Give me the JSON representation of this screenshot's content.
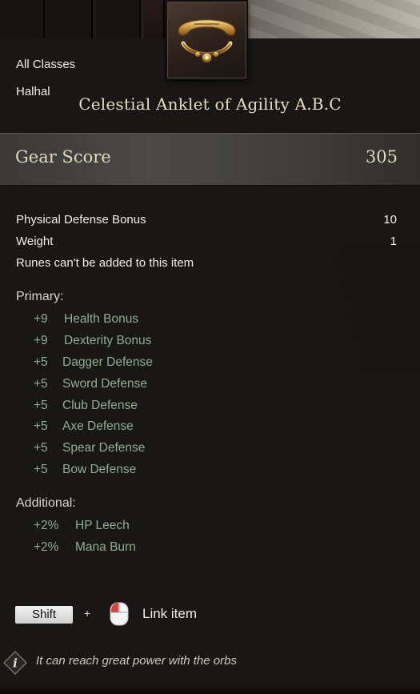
{
  "tooltip": {
    "class_restriction": "All Classes",
    "item_type": "Halhal",
    "item_name": "Celestial Anklet of Agility A.B.C",
    "icon": "golden-anklet-icon",
    "gear_score": {
      "label": "Gear Score",
      "value": "305"
    },
    "stats": [
      {
        "label": "Physical Defense Bonus",
        "value": "10"
      },
      {
        "label": "Weight",
        "value": "1"
      },
      {
        "label": "Runes can't be added to this item",
        "value": ""
      }
    ],
    "primary": {
      "title": "Primary:",
      "bonuses": [
        {
          "amount": "+9",
          "name": "Health Bonus"
        },
        {
          "amount": "+9",
          "name": "Dexterity Bonus"
        },
        {
          "amount": "+5",
          "name": "Dagger Defense"
        },
        {
          "amount": "+5",
          "name": "Sword Defense"
        },
        {
          "amount": "+5",
          "name": "Club Defense"
        },
        {
          "amount": "+5",
          "name": "Axe Defense"
        },
        {
          "amount": "+5",
          "name": "Spear Defense"
        },
        {
          "amount": "+5",
          "name": "Bow Defense"
        }
      ]
    },
    "additional": {
      "title": "Additional:",
      "bonuses": [
        {
          "amount": "+2%",
          "name": "HP Leech"
        },
        {
          "amount": "+2%",
          "name": "Mana Burn"
        }
      ]
    },
    "link_hint": {
      "key": "Shift",
      "plus": "+",
      "mouse_icon": "mouse-left-click-icon",
      "label": "Link item"
    },
    "flavor": {
      "icon": "info-icon",
      "text": "It can reach great power with the orbs"
    }
  },
  "colors": {
    "bonus_green": "#8fae8e",
    "title_gold": "#e8dcc0",
    "panel_bg": "#181716"
  }
}
